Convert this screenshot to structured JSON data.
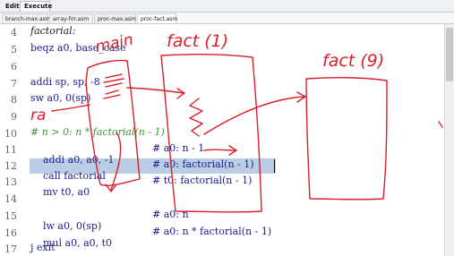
{
  "toolbar": {
    "tabs": [
      {
        "label": "Edit"
      },
      {
        "label": "Execute"
      }
    ]
  },
  "files": {
    "tabs": [
      {
        "label": "branch-max.asm"
      },
      {
        "label": "array-for.asm"
      },
      {
        "label": "proc-max.asm"
      },
      {
        "label": "proc-fact.asm"
      }
    ]
  },
  "editor": {
    "lines": [
      {
        "num": "4",
        "code": "factorial:"
      },
      {
        "num": "5",
        "code": "beqz a0, base_case"
      },
      {
        "num": "6",
        "code": ""
      },
      {
        "num": "7",
        "code": "addi sp, sp, -8"
      },
      {
        "num": "8",
        "code": "sw a0, 0(sp)"
      },
      {
        "num": "9",
        "code": ""
      },
      {
        "num": "10",
        "code": "# n > 0: n * factorial(n - 1)"
      },
      {
        "num": "11",
        "code": "addi a0, a0, -1",
        "comment": "# a0: n - 1"
      },
      {
        "num": "12",
        "code": "call factorial",
        "comment": "# a0: factorial(n - 1)"
      },
      {
        "num": "13",
        "code": "mv t0, a0",
        "comment": "# t0: factorial(n - 1)"
      },
      {
        "num": "14",
        "code": ""
      },
      {
        "num": "15",
        "code": "lw a0, 0(sp)",
        "comment": "# a0: n"
      },
      {
        "num": "16",
        "code": "mul a0, a0, t0",
        "comment": "# a0: n * factorial(n - 1)"
      },
      {
        "num": "17",
        "code": "j exit"
      }
    ]
  },
  "annotations": {
    "fact_1": "fact (1)",
    "fact_9": "fact (9)",
    "ra": "ra",
    "main": "main"
  }
}
